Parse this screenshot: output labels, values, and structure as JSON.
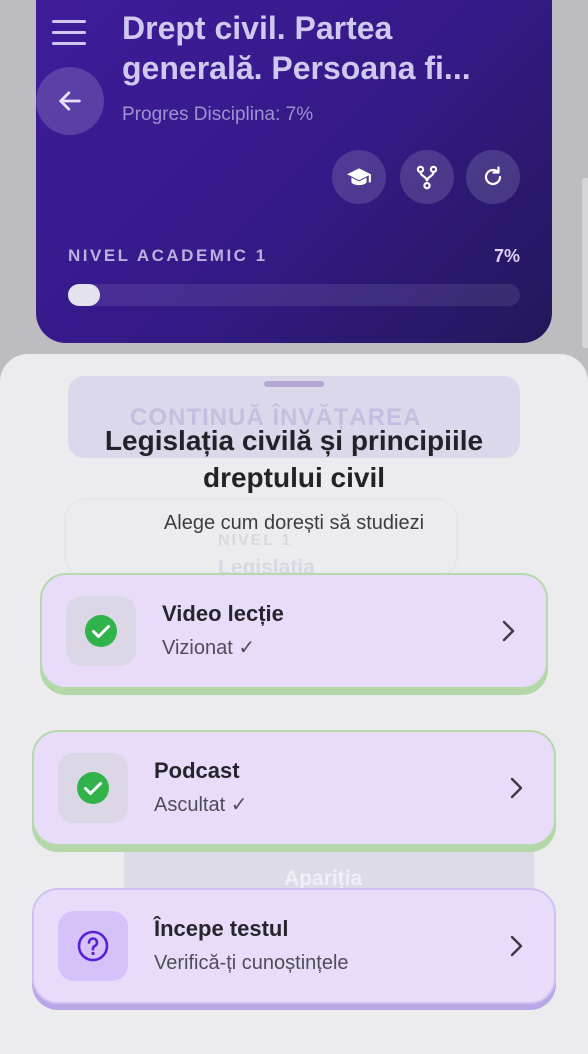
{
  "header": {
    "title": "Drept civil. Partea generală. Persoana fi...",
    "progress_text": "Progres Disciplina: 7%",
    "level_label": "NIVEL ACADEMIC 1",
    "level_percent": "7%",
    "progress_value": 0.07,
    "icons": [
      "graduation-cap-icon",
      "fork-icon",
      "refresh-icon"
    ]
  },
  "background": {
    "continue_button": "CONTINUĂ ÎNVĂȚAREA",
    "level_card_level": "NIVEL 1",
    "level_card_title": "Legislația",
    "strip_text": "Apariția"
  },
  "sheet": {
    "title": "Legislația civilă și principiile dreptului civil",
    "subtitle": "Alege cum dorești să studiezi",
    "options": [
      {
        "title": "Video lecție",
        "status": "Vizionat ✓",
        "icon": "check-circle-icon"
      },
      {
        "title": "Podcast",
        "status": "Ascultat ✓",
        "icon": "check-circle-icon"
      },
      {
        "title": "Începe testul",
        "status": "Verifică-ți cunoștințele",
        "icon": "question-circle-icon"
      }
    ]
  },
  "colors": {
    "header_gradient_start": "#3f1c9c",
    "header_gradient_end": "#24175a",
    "success_green": "#2fb34a",
    "test_purple": "#5a20d6",
    "card_bg": "#e9dcfb"
  }
}
